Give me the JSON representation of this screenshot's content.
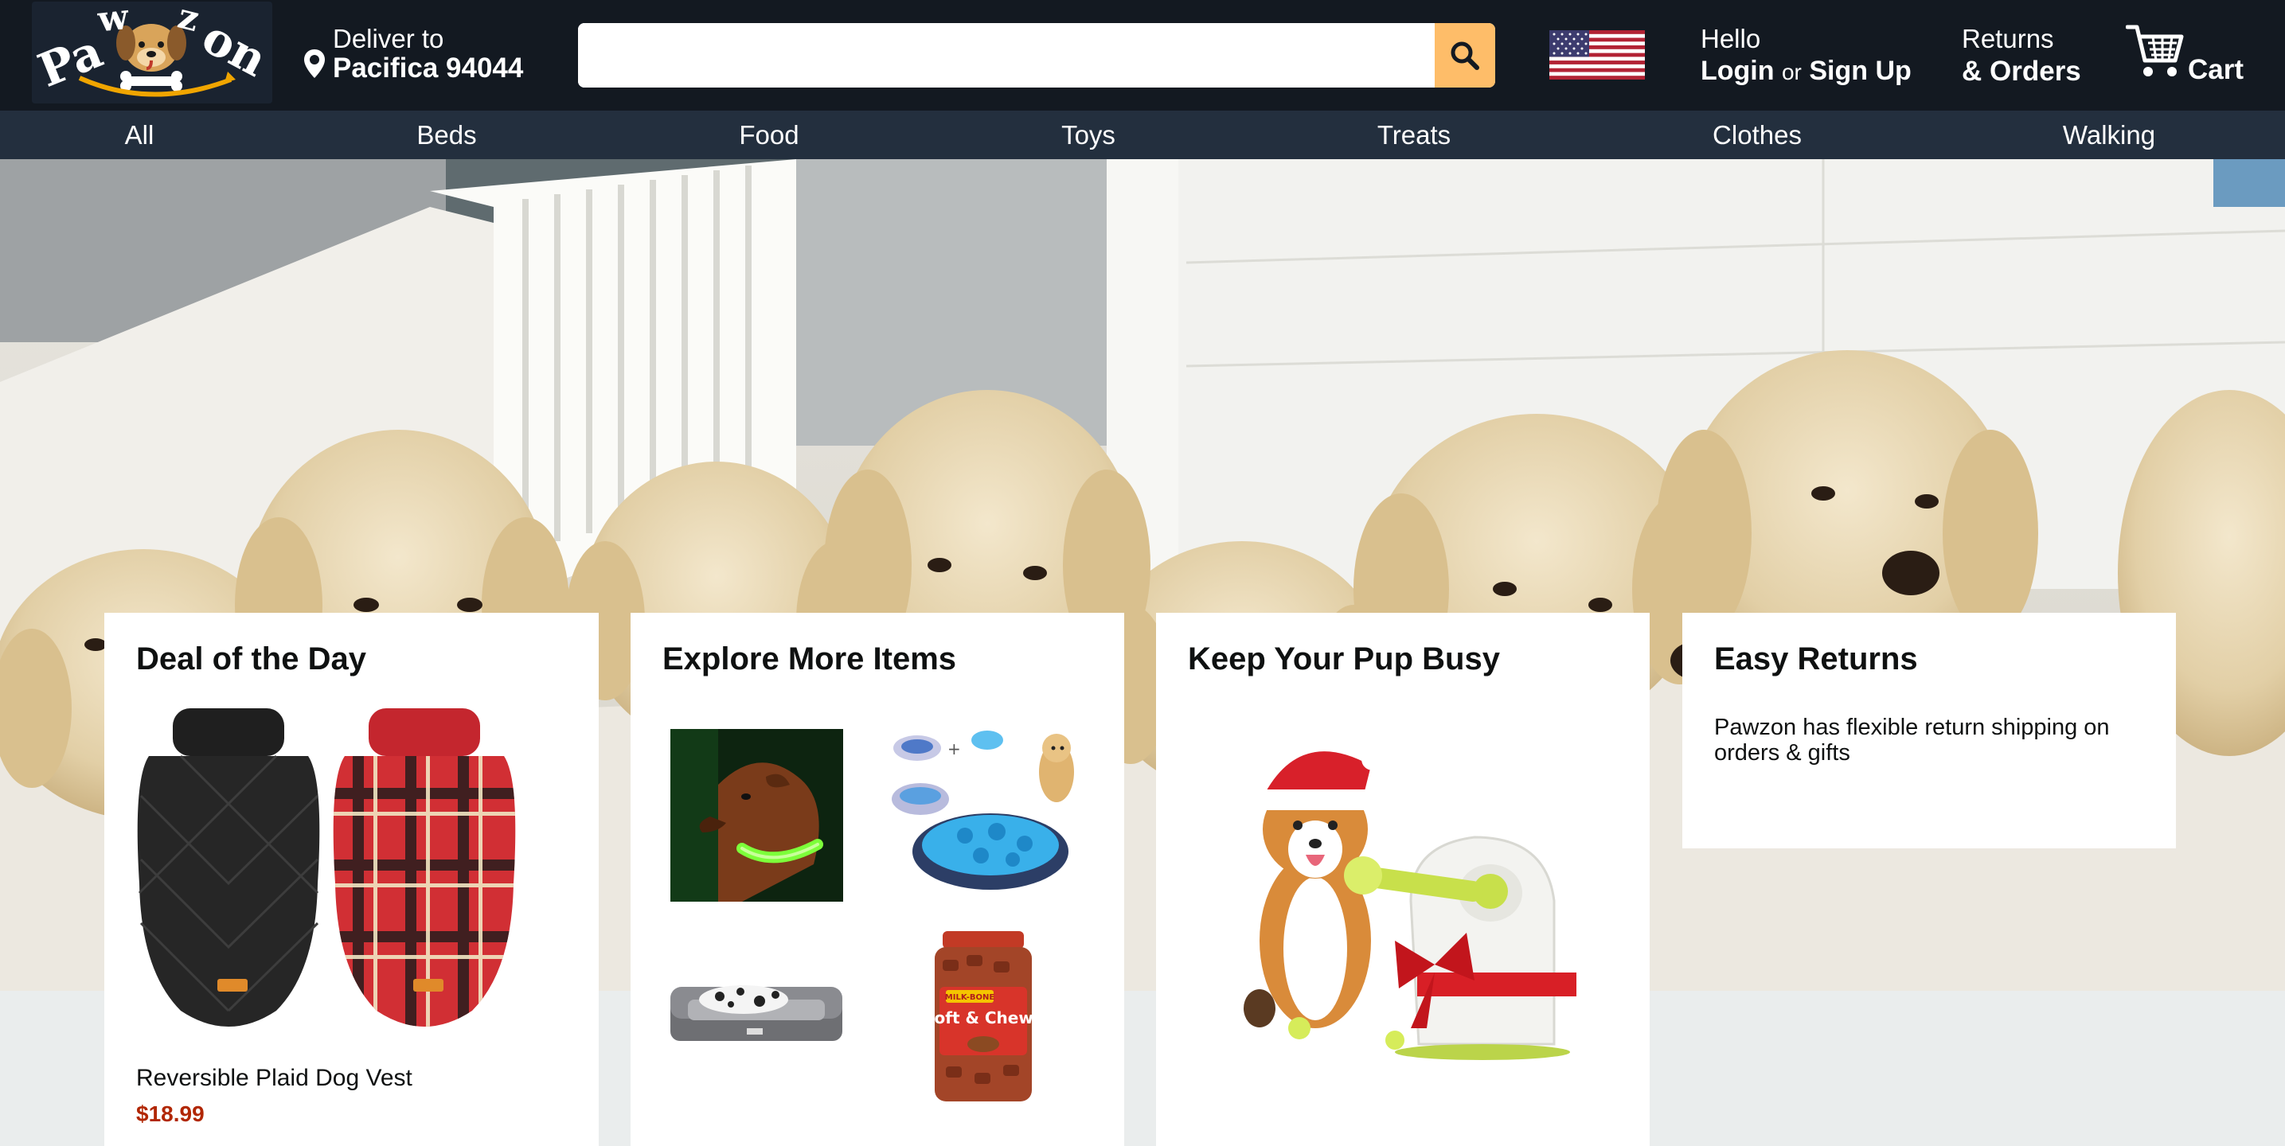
{
  "header": {
    "logo_text": "Pawzon",
    "deliver_label": "Deliver to",
    "deliver_location": "Pacifica 94044",
    "search_placeholder": "",
    "search_icon": "magnifier-icon",
    "flag": "us-flag-icon",
    "account_hello": "Hello",
    "account_login": "Login",
    "account_or": "or",
    "account_signup": "Sign Up",
    "returns_line1": "Returns",
    "returns_line2": "& Orders",
    "cart_icon": "shopping-cart-icon",
    "cart_label": "Cart"
  },
  "nav": {
    "items": [
      "All",
      "Beds",
      "Food",
      "Toys",
      "Treats",
      "Clothes",
      "Walking"
    ]
  },
  "hero": {
    "image": "golden-retriever-puppies-photo"
  },
  "cards": {
    "deal": {
      "title": "Deal of the Day",
      "product_name": "Reversible Plaid Dog Vest",
      "product_price": "$18.99"
    },
    "explore": {
      "title": "Explore More Items",
      "items": [
        "light-up-dog-collar",
        "snuffle-mat",
        "orthopedic-dog-bed",
        "soft-chewy-treats-jar"
      ],
      "treat_brand": "MILK-BONE",
      "treat_name": "Soft & Chewy"
    },
    "busy": {
      "title": "Keep Your Pup Busy",
      "image": "corgi-with-ball-launcher"
    },
    "returns": {
      "title": "Easy Returns",
      "text": "Pawzon has flexible return shipping on orders & gifts"
    }
  },
  "colors": {
    "header_bg": "#131921",
    "nav_bg": "#232f3e",
    "search_button": "#febd69",
    "price": "#b12704",
    "page_bg": "#eaeded"
  }
}
